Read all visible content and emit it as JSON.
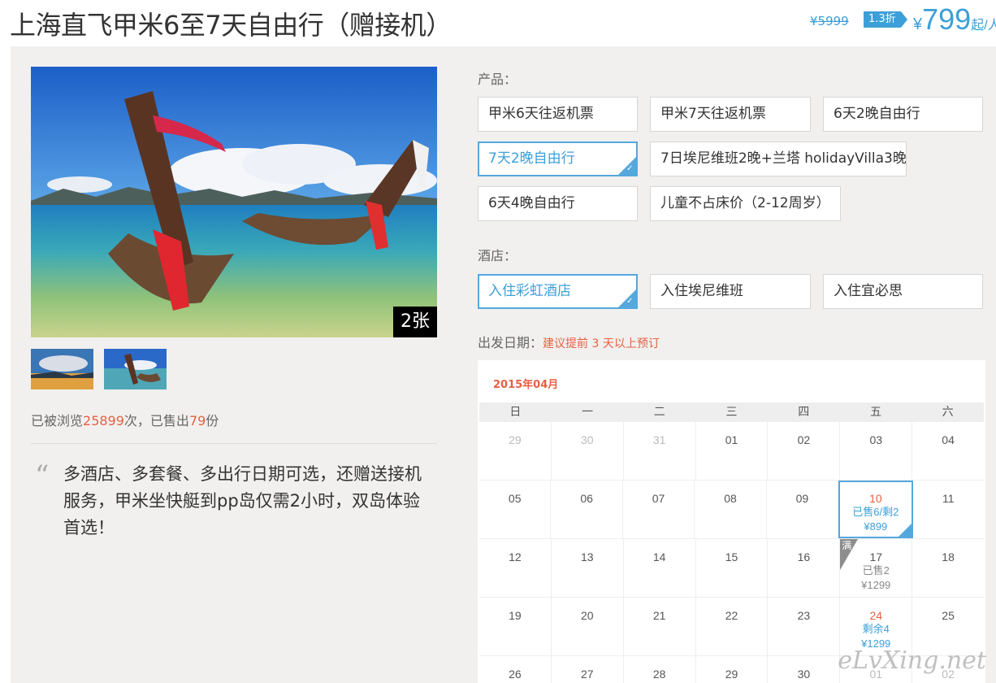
{
  "header": {
    "title": "上海直飞甲米6至7天自由行（赠接机）",
    "original_price": "¥5999",
    "discount": "1.3折",
    "price_symbol": "¥",
    "price": "799",
    "price_unit": "起/人"
  },
  "gallery": {
    "photo_count": "2张",
    "thumbnails": [
      "boat-scene-1",
      "boat-scene-2"
    ]
  },
  "stats": {
    "prefix": "已被浏览",
    "views": "25899",
    "middle": "次，已售出",
    "sold": "79",
    "suffix": "份"
  },
  "description": {
    "quote_icon": "quote-icon",
    "text": "多酒店、多套餐、多出行日期可选，还赠送接机服务，甲米坐快艇到pp岛仅需2小时，双岛体验首选！"
  },
  "products": {
    "label": "产品：",
    "options": [
      {
        "label": "甲米6天往返机票",
        "selected": false
      },
      {
        "label": "甲米7天往返机票",
        "selected": false
      },
      {
        "label": "6天2晚自由行",
        "selected": false
      },
      {
        "label": "7天2晚自由行",
        "selected": true
      },
      {
        "label": "7日埃尼维班2晚+兰塔 holidayVilla3晚",
        "selected": false
      },
      {
        "label": "6天4晚自由行",
        "selected": false
      },
      {
        "label": "儿童不占床价（2-12周岁）",
        "selected": false
      }
    ]
  },
  "hotels": {
    "label": "酒店：",
    "options": [
      {
        "label": "入住彩虹酒店",
        "selected": true
      },
      {
        "label": "入住埃尼维班",
        "selected": false
      },
      {
        "label": "入住宜必思",
        "selected": false
      }
    ]
  },
  "departure": {
    "label": "出发日期：",
    "hint": "建议提前 3 天以上预订"
  },
  "calendar": {
    "month": "2015年04月",
    "weekdays": [
      "日",
      "一",
      "二",
      "三",
      "四",
      "五",
      "六"
    ],
    "full_tag": "满",
    "rows": [
      [
        "29",
        "30",
        "31",
        "01",
        "02",
        "03",
        "04"
      ],
      [
        "05",
        "06",
        "07",
        "08",
        "09",
        "10",
        "11"
      ],
      [
        "12",
        "13",
        "14",
        "15",
        "16",
        "17",
        "18"
      ],
      [
        "19",
        "20",
        "21",
        "22",
        "23",
        "24",
        "25"
      ],
      [
        "26",
        "27",
        "28",
        "29",
        "30",
        "01",
        "02"
      ]
    ],
    "special": {
      "d10": {
        "line1": "已售6/剩2",
        "line2": "¥899"
      },
      "d17": {
        "line1": "已售2",
        "line2": "¥1299"
      },
      "d24": {
        "line1": "剩余4",
        "line2": "¥1299"
      }
    }
  },
  "watermark": "eLvXing.net",
  "colors": {
    "accent": "#3c9fd8",
    "highlight": "#e85f43",
    "panel": "#f1f0ee"
  }
}
